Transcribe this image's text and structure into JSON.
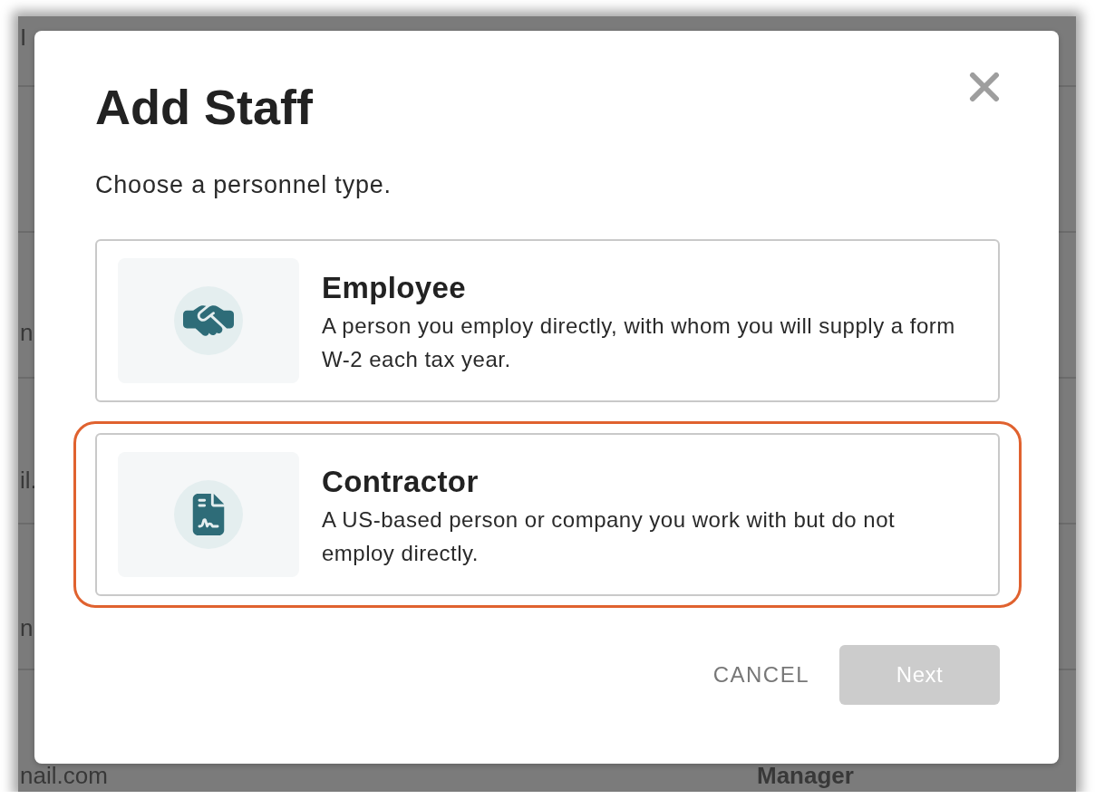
{
  "background_page": {
    "header": "I",
    "rows": [
      {
        "column_1": "n"
      },
      {
        "column_1": "il."
      },
      {
        "column_1": "n"
      },
      {
        "column_1": "nail.com",
        "column_2": "Manager"
      }
    ]
  },
  "dialog": {
    "title": "Add Staff",
    "prompt": "Choose a personnel type.",
    "options": [
      {
        "kind": "employee",
        "title": "Employee",
        "description": "A person you employ directly, with whom you will supply a form W-2 each tax year.",
        "highlighted": false
      },
      {
        "kind": "contractor",
        "title": "Contractor",
        "description": "A US-based person or company you work with but do not employ directly.",
        "highlighted": true
      }
    ],
    "buttons": [
      {
        "kind": "text",
        "label": "CANCEL",
        "disabled": false
      },
      {
        "kind": "primary",
        "label": "Next",
        "disabled": true
      }
    ]
  }
}
